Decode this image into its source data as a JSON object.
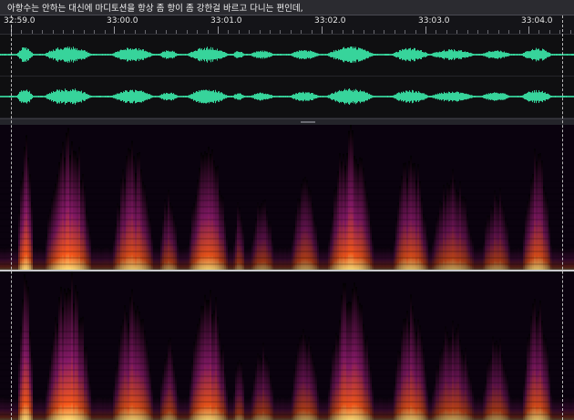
{
  "subtitle": {
    "text": "아항수는 안하는 대신에 마디토션을 항상 좀 항이 좀 강한걸 바르고 다니는 편인데,"
  },
  "ruler": {
    "labels": [
      "32:59.0",
      "33:00.0",
      "33:01.0",
      "33:02.0",
      "33:03.0",
      "33:04.0"
    ]
  },
  "colors": {
    "waveform": "#37d49b",
    "spectrogram_low": "#000000",
    "spectrogram_mid": "#8a1a6a",
    "spectrogram_high": "#ff5a1a",
    "spectrogram_peak": "#ffe27a",
    "selection_marker": "#d7d7d7"
  },
  "icons": {
    "splitter": "drag-handle-icon"
  }
}
